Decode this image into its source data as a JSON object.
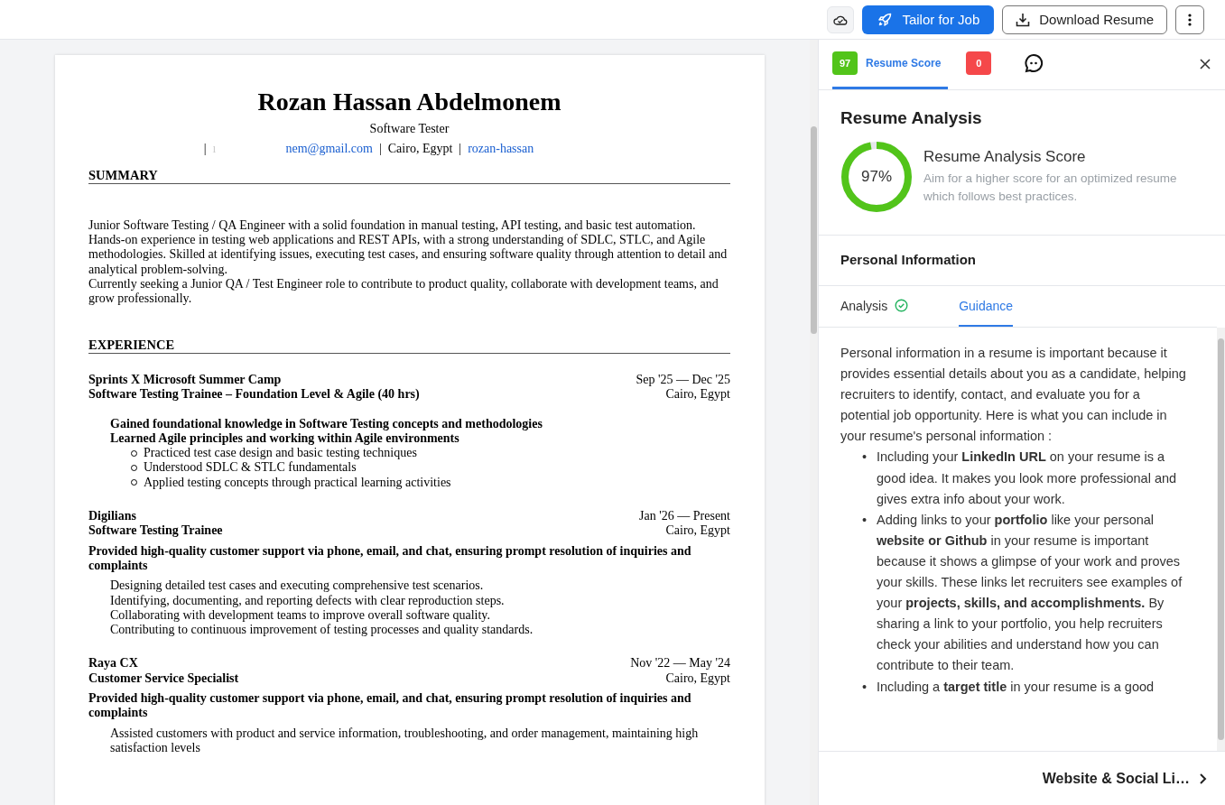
{
  "toolbar": {
    "tailor_button": "Tailor for Job",
    "download_button": "Download Resume"
  },
  "resume": {
    "name": "Rozan Hassan Abdelmonem",
    "title": "Software Tester",
    "contact": [
      {
        "kind": "sep",
        "text": "|"
      },
      {
        "kind": "faint",
        "text": "ı"
      },
      {
        "kind": "link",
        "text": "nem@gmail.com"
      },
      {
        "kind": "sep",
        "text": "|"
      },
      {
        "kind": "text",
        "text": "Cairo, Egypt"
      },
      {
        "kind": "sep",
        "text": "|"
      },
      {
        "kind": "link",
        "text": "rozan-hassan"
      }
    ],
    "sections": [
      {
        "heading": "SUMMARY",
        "kind": "summary",
        "paragraphs": [
          "Junior Software Testing / QA Engineer with a solid foundation in manual testing, API testing, and basic test automation.",
          "Hands-on experience in testing web applications and REST APIs, with a strong understanding of SDLC, STLC, and Agile methodologies. Skilled at identifying issues, executing test cases, and ensuring software quality through attention to detail and analytical problem-solving.",
          "Currently seeking a Junior QA / Test Engineer role to contribute to product quality, collaborate with development teams, and grow professionally."
        ]
      },
      {
        "heading": "EXPERIENCE",
        "kind": "experience",
        "entries": [
          {
            "company": "Sprints X Microsoft Summer Camp",
            "dates": "Sep '25 — Dec '25",
            "role": "Software Testing Trainee – Foundation Level & Agile (40 hrs)",
            "location": "Cairo, Egypt",
            "blocks": [
              {
                "kind": "bold-indent",
                "lines": [
                  "Gained foundational knowledge in Software Testing concepts and methodologies",
                  "Learned Agile principles and working within Agile environments"
                ]
              },
              {
                "kind": "circle-list",
                "lines": [
                  "Practiced test case design and basic testing techniques",
                  "Understood SDLC & STLC fundamentals",
                  "Applied testing concepts through practical learning activities"
                ]
              }
            ]
          },
          {
            "company": "Digilians",
            "dates": "Jan '26 — Present",
            "role": "Software Testing Trainee",
            "location": "Cairo, Egypt",
            "blocks": [
              {
                "kind": "bold",
                "lines": [
                  "Provided high-quality customer support via phone, email, and chat, ensuring prompt resolution of inquiries and complaints"
                ]
              },
              {
                "kind": "indent",
                "lines": [
                  "Designing detailed test cases and executing comprehensive test scenarios.",
                  "Identifying, documenting, and reporting defects with clear reproduction steps.",
                  "Collaborating with development teams to improve overall software quality.",
                  "Contributing to continuous improvement of testing processes and quality standards."
                ]
              }
            ]
          },
          {
            "company": "Raya CX",
            "dates": "Nov '22 — May '24",
            "role": "Customer Service Specialist",
            "location": "Cairo, Egypt",
            "blocks": [
              {
                "kind": "bold",
                "lines": [
                  "Provided high-quality customer support via phone, email, and chat, ensuring prompt resolution of inquiries and complaints"
                ]
              },
              {
                "kind": "indent",
                "lines": [
                  "Assisted customers with product and service information, troubleshooting, and order management, maintaining high satisfaction levels"
                ]
              }
            ]
          }
        ]
      }
    ]
  },
  "panel": {
    "tabs": [
      {
        "kind": "score",
        "badge": "97",
        "label": "Resume Score",
        "selected": true
      },
      {
        "kind": "issues",
        "badge": "0",
        "selected": false
      },
      {
        "kind": "chat",
        "selected": false
      }
    ],
    "title": "Resume Analysis",
    "score": {
      "value": "97%",
      "level": 0.97,
      "title": "Resume Analysis Score",
      "description": "Aim for a higher score for an optimized resume which follows best practices."
    },
    "section_title": "Personal Information",
    "subtabs": [
      {
        "label": "Analysis",
        "done": true,
        "selected": false
      },
      {
        "label": "Guidance",
        "done": false,
        "selected": true
      }
    ],
    "guidance": {
      "intro": "Personal information in a resume is important because it provides essential details about you as a candidate, helping recruiters to identify, contact, and evaluate you for a potential job opportunity. Here is what you can include in your resume's personal information :",
      "bullets": [
        {
          "marker": "•",
          "text": "Including your **LinkedIn URL** on your resume is a good idea. It makes you look more professional and gives extra info about your work."
        },
        {
          "marker": "•",
          "text": "Adding links to your **portfolio** like your personal **website or Github** in your resume is important because it shows a glimpse of your work and proves your skills. These links let recruiters see examples of your **projects, skills, and accomplishments.** By sharing a link to your portfolio, you help recruiters check your abilities and understand how you can contribute to their team."
        },
        {
          "marker": "•",
          "text": "Including a **target title** in your resume is a good"
        }
      ]
    },
    "next_link": "Website & Social Li…"
  }
}
